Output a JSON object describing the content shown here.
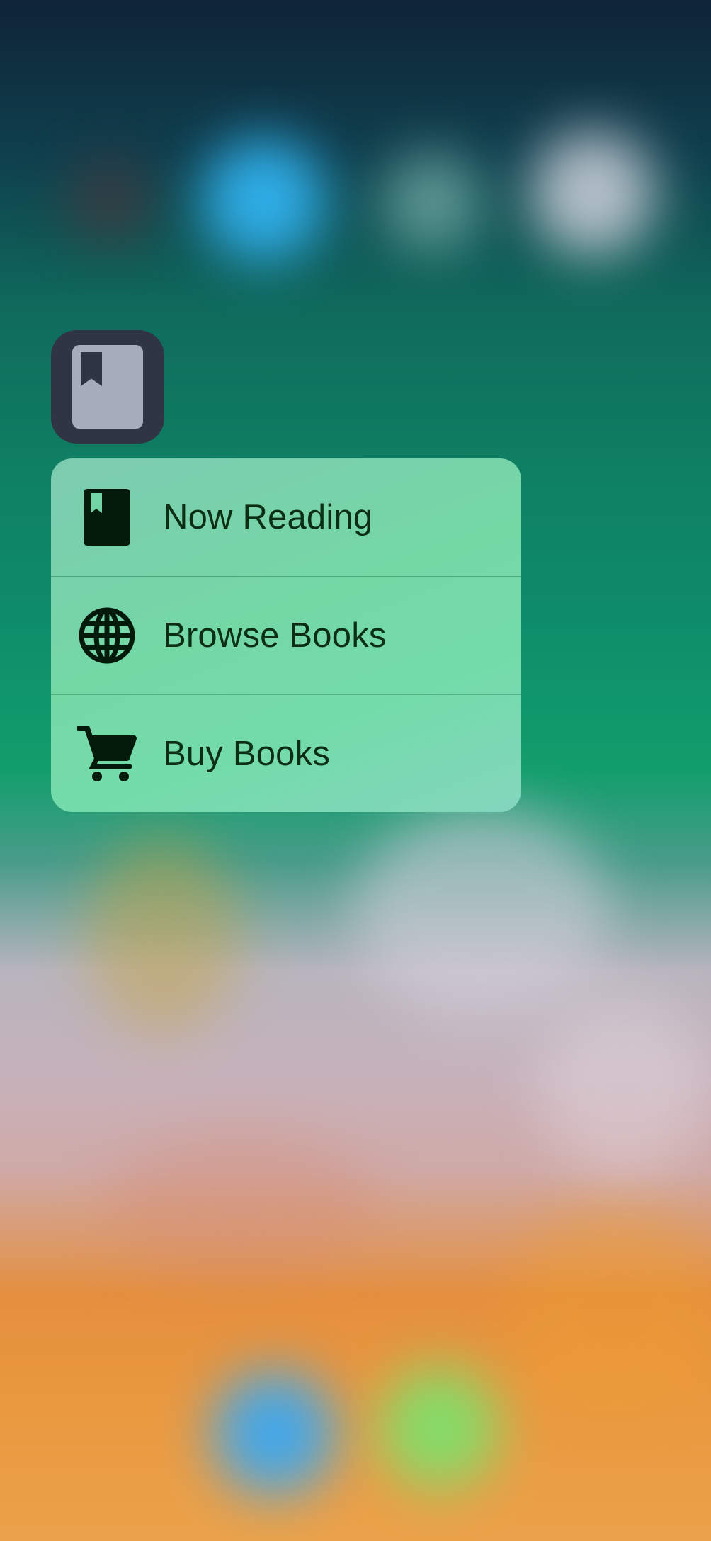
{
  "app": {
    "icon_name": "book-icon"
  },
  "quick_actions": [
    {
      "label": "Now Reading",
      "icon": "book-icon"
    },
    {
      "label": "Browse Books",
      "icon": "globe-icon"
    },
    {
      "label": "Buy Books",
      "icon": "cart-icon"
    }
  ],
  "colors": {
    "menu_background": "#75d6a8",
    "label_text": "#0b2e14",
    "app_icon_background": "#2f3545",
    "app_icon_page": "#a7acbd"
  }
}
